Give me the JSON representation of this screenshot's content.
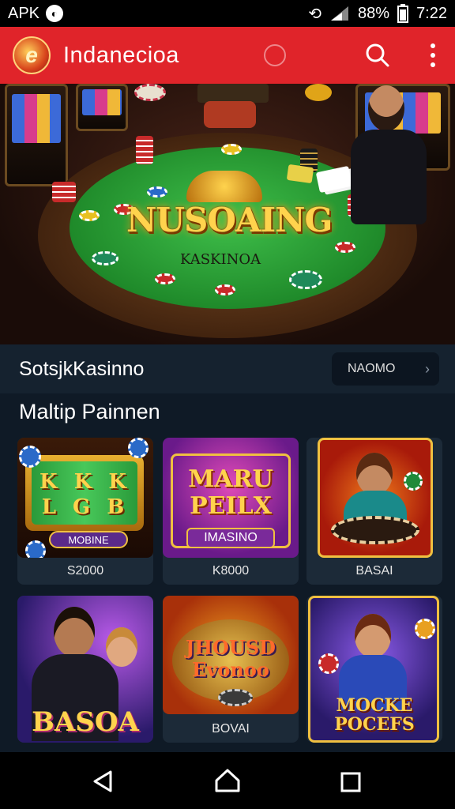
{
  "status_bar": {
    "left_label": "APK",
    "battery": "88%",
    "time": "7:22"
  },
  "app_bar": {
    "title": "Indanecioa"
  },
  "hero": {
    "title": "NUSOAING",
    "subtitle": "KASKINOA"
  },
  "section": {
    "title": "SotsjkKasinno",
    "more_label": "NAOMO"
  },
  "grid": {
    "title": "Maltip Painnen",
    "cards": [
      {
        "art_text": "K K K L G B",
        "badge": "MOBINE",
        "caption": "S2000"
      },
      {
        "art_text": "MARU PEILX",
        "badge": "IMASINO",
        "caption": "K8000"
      },
      {
        "art_text": "",
        "badge": "",
        "caption": "BASAI"
      },
      {
        "art_text": "BASOA",
        "badge": "",
        "caption": ""
      },
      {
        "art_text": "JHOUSD Evonoo",
        "badge": "",
        "caption": "BOVAI"
      },
      {
        "art_text": "MOCKE POCEFS",
        "badge": "",
        "caption": ""
      }
    ]
  },
  "colors": {
    "accent": "#e0242a",
    "background": "#0f1a26",
    "felt": "#2aa23a",
    "gold": "#ffd34d"
  },
  "icons": [
    "signal-icon",
    "battery-icon",
    "search-icon",
    "more-vert-icon",
    "back-icon",
    "home-icon",
    "recents-icon"
  ]
}
